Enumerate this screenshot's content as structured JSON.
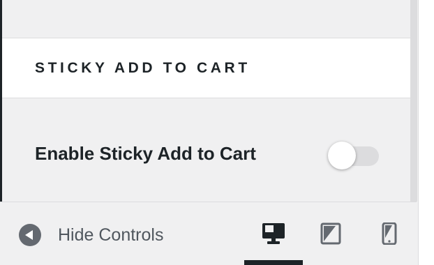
{
  "section": {
    "title": "STICKY ADD TO CART"
  },
  "control": {
    "label": "Enable Sticky Add to Cart",
    "enabled": false
  },
  "footer": {
    "hide_controls_label": "Hide Controls",
    "devices": [
      {
        "icon": "desktop-icon",
        "active": true
      },
      {
        "icon": "tablet-icon",
        "active": false
      },
      {
        "icon": "mobile-icon",
        "active": false
      }
    ]
  },
  "colors": {
    "accent": "#1d2327",
    "toggle_off": "#dcdcde",
    "panel_bg": "#f0f0f1"
  }
}
